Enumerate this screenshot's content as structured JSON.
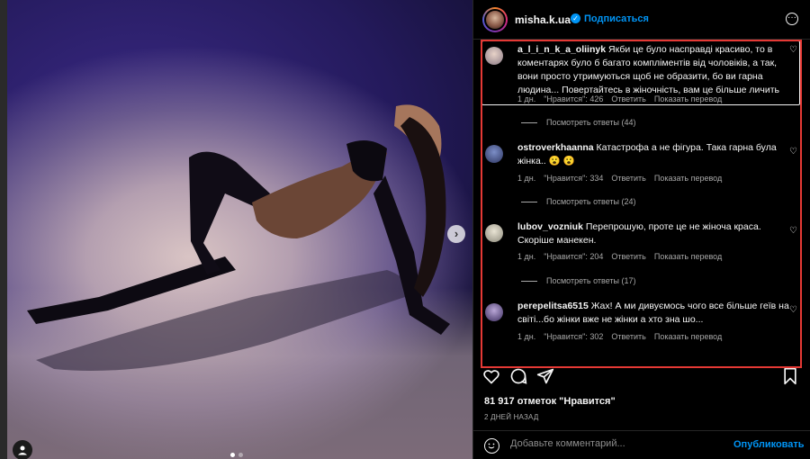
{
  "post": {
    "author": "misha.k.ua",
    "follow_label": "Подписаться",
    "likes": "81 917 отметок \"Нравится\"",
    "date": "2 ДНЕЙ НАЗАД",
    "carousel": {
      "count": 2,
      "active": 1
    }
  },
  "comments": [
    {
      "user": "a_l_i_n_k_a_oliinyk",
      "text": "Якби це було насправді красиво, то в коментарях було б багато компліментів від чоловіків, а так, вони просто утримуються щоб не образити, бо ви гарна людина... Повертайтесь в жіночність, вам це більше личить",
      "time": "1 дн.",
      "likes": "\"Нравится\": 426",
      "reply": "Ответить",
      "translate": "Показать перевод",
      "replies": "Посмотреть ответы (44)"
    },
    {
      "user": "ostroverkhaanna",
      "text": "Катастрофа а не фігура. Така гарна була жінка.. 😮 😮",
      "time": "1 дн.",
      "likes": "\"Нравится\": 334",
      "reply": "Ответить",
      "translate": "Показать перевод",
      "replies": "Посмотреть ответы (24)"
    },
    {
      "user": "lubov_vozniuk",
      "text": "Перепрошую, проте це не жіноча краса. Скоріше манекен.",
      "time": "1 дн.",
      "likes": "\"Нравится\": 204",
      "reply": "Ответить",
      "translate": "Показать перевод",
      "replies": "Посмотреть ответы (17)"
    },
    {
      "user": "perepelitsa6515",
      "text": "Жах! А ми дивуємось чого все більше геїв на світі...бо жінки вже не жінки а хто зна шо...",
      "time": "1 дн.",
      "likes": "\"Нравится\": 302",
      "reply": "Ответить",
      "translate": "Показать перевод"
    }
  ],
  "composer": {
    "placeholder": "Добавьте комментарий...",
    "publish_label": "Опубликовать"
  },
  "icons": {
    "verified": "verified-badge-icon",
    "more": "more-options-icon",
    "like": "heart-icon",
    "comment": "comment-icon",
    "share": "share-icon",
    "save": "bookmark-icon",
    "emoji": "emoji-icon",
    "next": "chevron-right-icon",
    "user_tag": "user-tag-icon"
  },
  "colors": {
    "accent": "#0095f6",
    "highlight_box": "#e53935"
  }
}
